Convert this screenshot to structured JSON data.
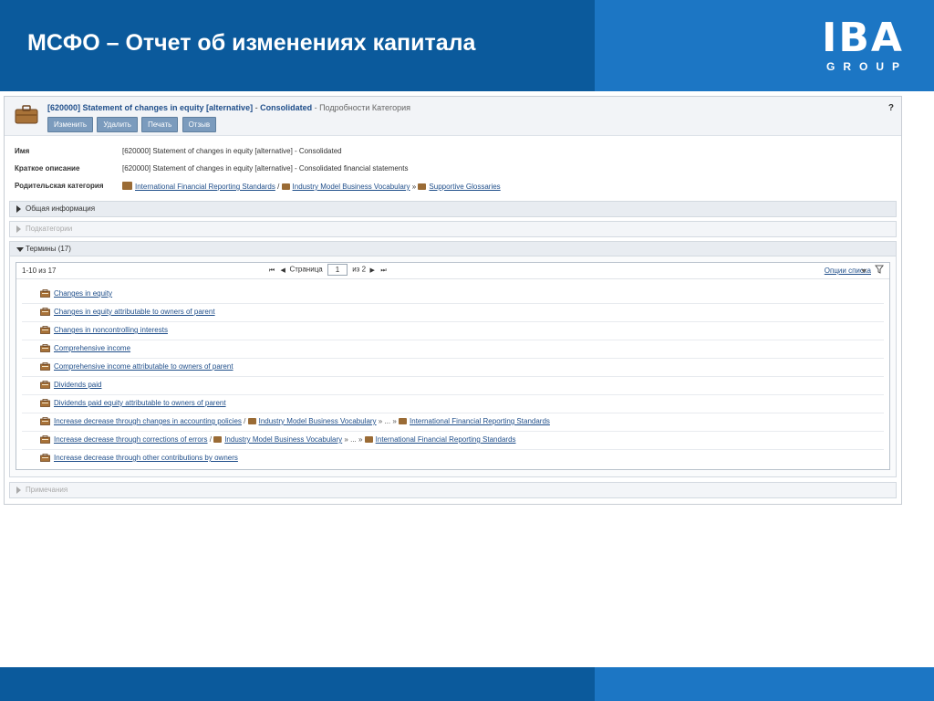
{
  "slide": {
    "title": "МСФО – Отчет об изменениях капитала",
    "logo_main": "IBA",
    "logo_sub": "GROUP",
    "colors": {
      "dark_blue": "#0b5a9c",
      "light_blue": "#1c76c4"
    }
  },
  "header": {
    "code": "[620000] Statement of changes in equity [alternative]",
    "separator": " - ",
    "name_tail": "Consolidated",
    "crumb": " - Подробности Категория",
    "help": "?",
    "buttons": {
      "edit": "Изменить",
      "delete": "Удалить",
      "print": "Печать",
      "feedback": "Отзыв"
    }
  },
  "props": {
    "name_label": "Имя",
    "name_value": "[620000] Statement of changes in equity [alternative] - Consolidated",
    "desc_label": "Краткое описание",
    "desc_value": "[620000] Statement of changes in equity [alternative] - Consolidated financial statements",
    "parent_label": "Родительская категория",
    "parent_links": [
      "International Financial Reporting Standards",
      "Industry Model Business Vocabulary",
      "Supportive Glossaries"
    ],
    "parent_sep1": " / ",
    "parent_sep2": " » "
  },
  "sections": {
    "general": "Общая информация",
    "subcategories": "Подкатегории",
    "terms": "Термины (17)",
    "notes": "Примечания"
  },
  "pager": {
    "range": "1-10 из 17",
    "page_label": "Страница",
    "page_value": "1",
    "of_label": "из 2",
    "list_options": "Опции списка",
    "first": "⏮",
    "prev": "◀",
    "next": "▶",
    "last": "⏭"
  },
  "terms": [
    {
      "label": "Changes in equity"
    },
    {
      "label": "Changes in equity attributable to owners of parent"
    },
    {
      "label": "Changes in noncontrolling interests"
    },
    {
      "label": "Comprehensive income"
    },
    {
      "label": "Comprehensive income attributable to owners of parent"
    },
    {
      "label": "Dividends paid"
    },
    {
      "label": "Dividends paid equity attributable to owners of parent"
    },
    {
      "label": "Increase decrease through changes in accounting policies",
      "path_sep": " / ",
      "path1": "Industry Model Business Vocabulary",
      "path_mid": " » ... » ",
      "path2": "International Financial Reporting Standards"
    },
    {
      "label": "Increase decrease through corrections of errors",
      "path_sep": " / ",
      "path1": "Industry Model Business Vocabulary",
      "path_mid": " » ... » ",
      "path2": "International Financial Reporting Standards"
    },
    {
      "label": "Increase decrease through other contributions by owners"
    }
  ]
}
